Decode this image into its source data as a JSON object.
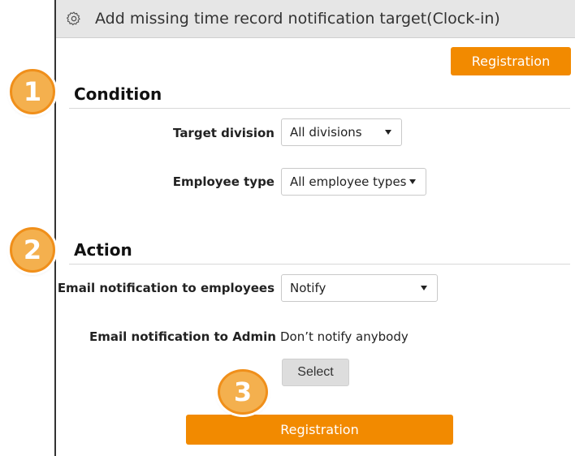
{
  "header": {
    "title": "Add missing time record notification target(Clock-in)",
    "icon": "gear-icon"
  },
  "buttons": {
    "registration_top": "Registration",
    "registration_bottom": "Registration",
    "select": "Select"
  },
  "condition": {
    "title": "Condition",
    "target_division": {
      "label": "Target division",
      "value": "All divisions"
    },
    "employee_type": {
      "label": "Employee type",
      "value": "All employee types"
    }
  },
  "action": {
    "title": "Action",
    "email_employees": {
      "label": "Email notification to employees",
      "value": "Notify"
    },
    "email_admin": {
      "label": "Email notification to Admin",
      "value": "Don’t notify anybody"
    }
  },
  "badges": {
    "one": "1",
    "two": "2",
    "three": "3"
  },
  "colors": {
    "accent": "#f28a00",
    "badge": "#f4b04e",
    "title_bar": "#e6e6e6"
  }
}
